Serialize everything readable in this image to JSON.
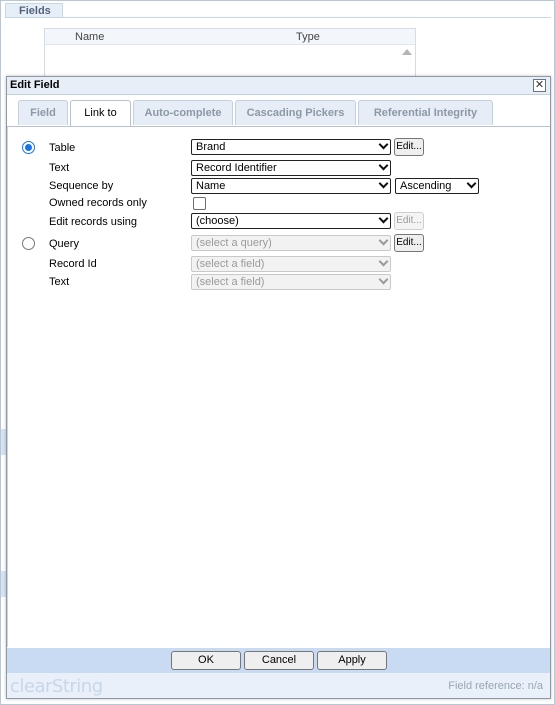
{
  "background": {
    "fields_tab": "Fields",
    "grid_headers": [
      "Name",
      "Type"
    ]
  },
  "dialog": {
    "title": "Edit Field",
    "tabs": [
      {
        "label": "Field",
        "active": false
      },
      {
        "label": "Link to",
        "active": true
      },
      {
        "label": "Auto-complete",
        "active": false
      },
      {
        "label": "Cascading Pickers",
        "active": false
      },
      {
        "label": "Referential Integrity",
        "active": false
      }
    ],
    "table_option": {
      "label": "Table",
      "selected": true,
      "table_value": "Brand",
      "edit_label": "Edit...",
      "text_label": "Text",
      "text_value": "Record Identifier",
      "sequence_label": "Sequence by",
      "sequence_value": "Name",
      "order_value": "Ascending",
      "owned_label": "Owned records only",
      "owned_checked": false,
      "edit_using_label": "Edit records using",
      "edit_using_value": "(choose)",
      "edit_using_button": "Edit..."
    },
    "query_option": {
      "label": "Query",
      "selected": false,
      "query_placeholder": "(select a query)",
      "edit_label": "Edit...",
      "record_id_label": "Record Id",
      "record_id_value": "(select a field)",
      "text_label": "Text",
      "text_value": "(select a field)"
    },
    "buttons": {
      "ok": "OK",
      "cancel": "Cancel",
      "apply": "Apply"
    },
    "footer": {
      "brand": "clearString",
      "field_reference": "Field reference: n/a"
    }
  },
  "colors": {
    "accent": "#1a73e8",
    "title_bar": "#e7eef7",
    "footer_bar": "#c9dbf3"
  }
}
